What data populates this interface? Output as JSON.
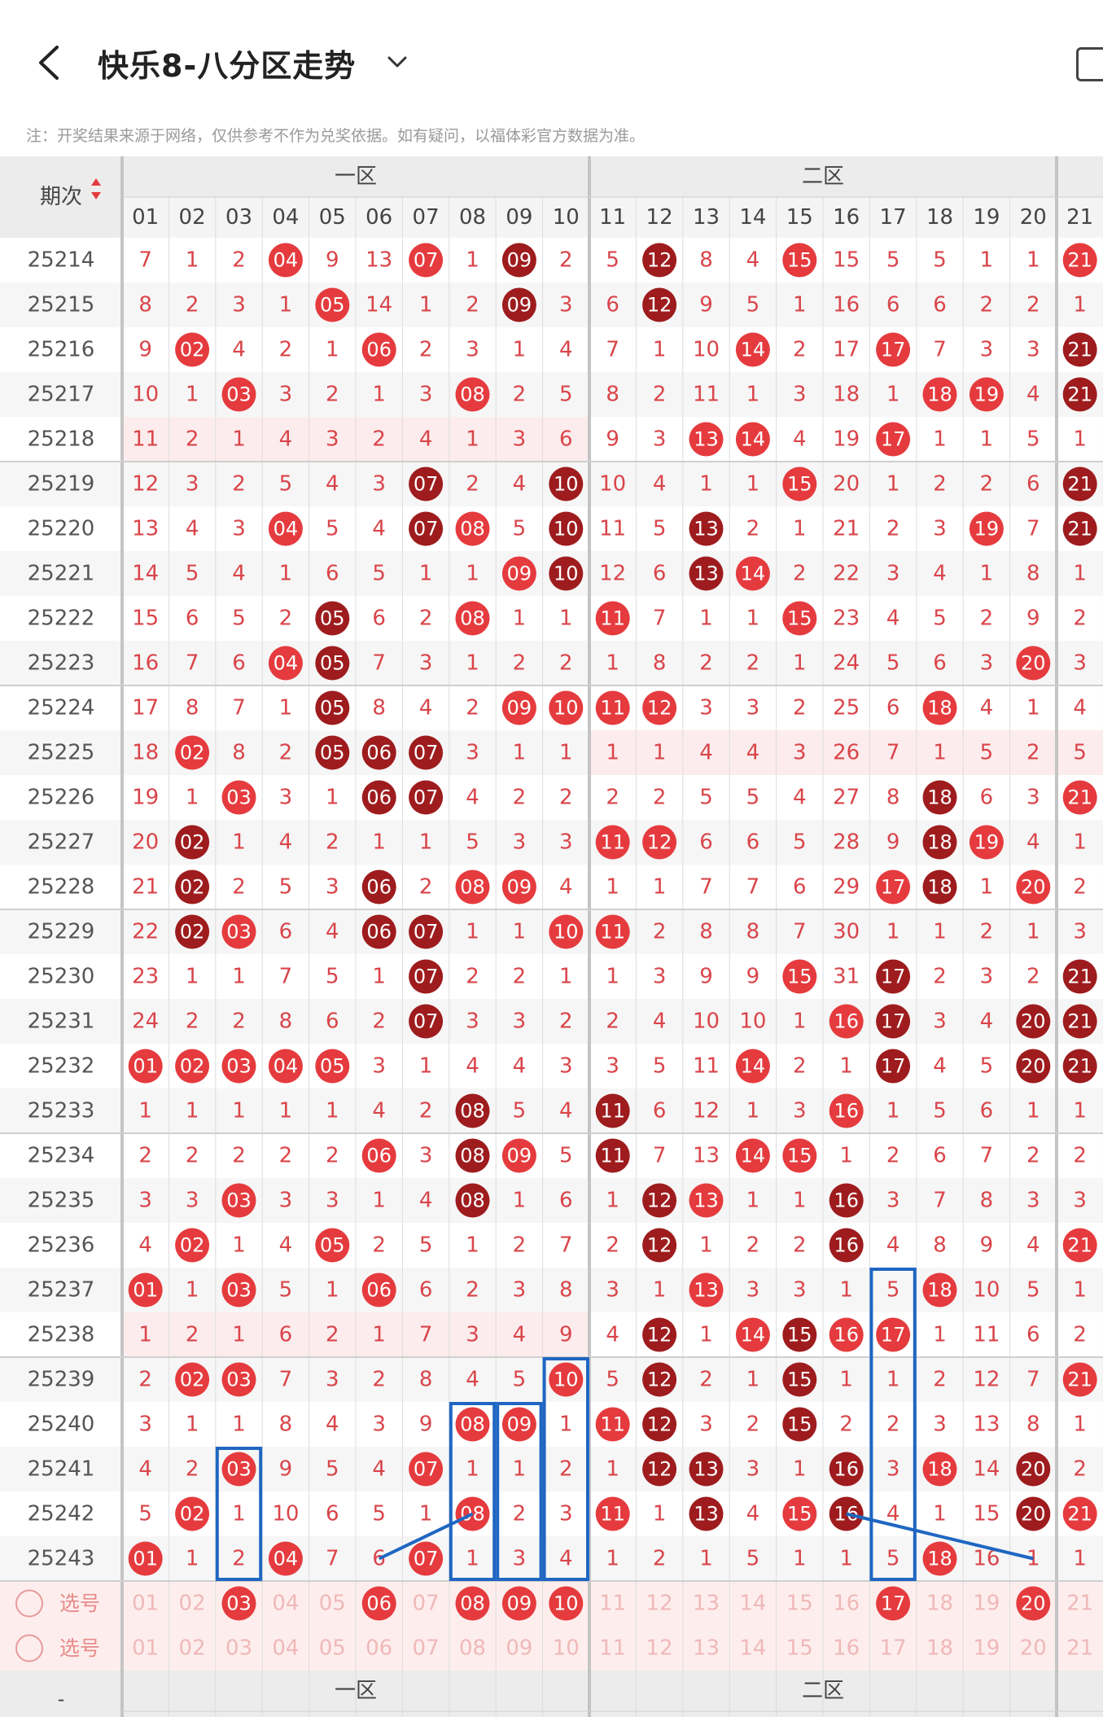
{
  "header": {
    "title": "快乐8-八分区走势",
    "back_icon": "chevron-left-icon",
    "dropdown_icon": "chevron-down-icon",
    "side_icon": "split-view-icon"
  },
  "note": "注：开奖结果来源于网络，仅供参考不作为兑奖依据。如有疑问，以福体彩官方数据为准。",
  "table": {
    "period_header": "期次",
    "zones": [
      "一区",
      "二区"
    ],
    "columns": [
      "01",
      "02",
      "03",
      "04",
      "05",
      "06",
      "07",
      "08",
      "09",
      "10",
      "11",
      "12",
      "13",
      "14",
      "15",
      "16",
      "17",
      "18",
      "19",
      "20",
      "21"
    ],
    "rows": [
      {
        "p": "25214",
        "v": [
          7,
          1,
          2,
          "04",
          9,
          13,
          "07",
          1,
          "09",
          2,
          5,
          "12",
          8,
          4,
          "15",
          15,
          5,
          5,
          1,
          1,
          "21"
        ]
      },
      {
        "p": "25215",
        "v": [
          8,
          2,
          3,
          1,
          "05",
          14,
          1,
          2,
          "09",
          3,
          6,
          "12",
          9,
          5,
          1,
          16,
          6,
          6,
          2,
          2,
          1
        ]
      },
      {
        "p": "25216",
        "v": [
          9,
          "02",
          4,
          2,
          1,
          "06",
          2,
          3,
          1,
          4,
          7,
          1,
          10,
          "14",
          2,
          17,
          "17",
          7,
          3,
          3,
          "21"
        ]
      },
      {
        "p": "25217",
        "v": [
          10,
          1,
          "03",
          3,
          2,
          1,
          3,
          "08",
          2,
          5,
          8,
          2,
          11,
          1,
          3,
          18,
          1,
          "18",
          "19",
          4,
          "21"
        ]
      },
      {
        "p": "25218",
        "v": [
          11,
          2,
          1,
          4,
          3,
          2,
          4,
          1,
          3,
          6,
          9,
          3,
          "13",
          "14",
          4,
          19,
          "17",
          1,
          1,
          5,
          1
        ]
      },
      {
        "p": "25219",
        "v": [
          12,
          3,
          2,
          5,
          4,
          3,
          "07",
          2,
          4,
          "10",
          10,
          4,
          1,
          1,
          "15",
          20,
          1,
          2,
          2,
          6,
          "21"
        ]
      },
      {
        "p": "25220",
        "v": [
          13,
          4,
          3,
          "04",
          5,
          4,
          "07",
          "08",
          5,
          "10",
          11,
          5,
          "13",
          2,
          1,
          21,
          2,
          3,
          "19",
          7,
          "21"
        ]
      },
      {
        "p": "25221",
        "v": [
          14,
          5,
          4,
          1,
          6,
          5,
          1,
          1,
          "09",
          "10",
          12,
          6,
          "13",
          "14",
          2,
          22,
          3,
          4,
          1,
          8,
          1
        ]
      },
      {
        "p": "25222",
        "v": [
          15,
          6,
          5,
          2,
          "05",
          6,
          2,
          "08",
          1,
          1,
          "11",
          7,
          1,
          1,
          "15",
          23,
          4,
          5,
          2,
          9,
          2
        ]
      },
      {
        "p": "25223",
        "v": [
          16,
          7,
          6,
          "04",
          "05",
          7,
          3,
          1,
          2,
          2,
          1,
          8,
          2,
          2,
          1,
          24,
          5,
          6,
          3,
          "20",
          3
        ]
      },
      {
        "p": "25224",
        "v": [
          17,
          8,
          7,
          1,
          "05",
          8,
          4,
          2,
          "09",
          "10",
          "11",
          "12",
          3,
          3,
          2,
          25,
          6,
          "18",
          4,
          1,
          4
        ]
      },
      {
        "p": "25225",
        "v": [
          18,
          "02",
          8,
          2,
          "05",
          "06",
          "07",
          3,
          1,
          1,
          1,
          1,
          4,
          4,
          3,
          26,
          7,
          1,
          5,
          2,
          5
        ]
      },
      {
        "p": "25226",
        "v": [
          19,
          1,
          "03",
          3,
          1,
          "06",
          "07",
          4,
          2,
          2,
          2,
          2,
          5,
          5,
          4,
          27,
          8,
          "18",
          6,
          3,
          "21"
        ]
      },
      {
        "p": "25227",
        "v": [
          20,
          "02",
          1,
          4,
          2,
          1,
          1,
          5,
          3,
          3,
          "11",
          "12",
          6,
          6,
          5,
          28,
          9,
          "18",
          "19",
          4,
          1
        ]
      },
      {
        "p": "25228",
        "v": [
          21,
          "02",
          2,
          5,
          3,
          "06",
          2,
          "08",
          "09",
          4,
          1,
          1,
          7,
          7,
          6,
          29,
          "17",
          "18",
          1,
          "20",
          2
        ]
      },
      {
        "p": "25229",
        "v": [
          22,
          "02",
          "03",
          6,
          4,
          "06",
          "07",
          1,
          1,
          "10",
          "11",
          2,
          8,
          8,
          7,
          30,
          1,
          1,
          2,
          1,
          3
        ]
      },
      {
        "p": "25230",
        "v": [
          23,
          1,
          1,
          7,
          5,
          1,
          "07",
          2,
          2,
          1,
          1,
          3,
          9,
          9,
          "15",
          31,
          "17",
          2,
          3,
          2,
          "21"
        ]
      },
      {
        "p": "25231",
        "v": [
          24,
          2,
          2,
          8,
          6,
          2,
          "07",
          3,
          3,
          2,
          2,
          4,
          10,
          10,
          1,
          "16",
          "17",
          3,
          4,
          "20",
          "21"
        ]
      },
      {
        "p": "25232",
        "v": [
          "01",
          "02",
          "03",
          "04",
          "05",
          3,
          1,
          4,
          4,
          3,
          3,
          5,
          11,
          "14",
          2,
          1,
          "17",
          4,
          5,
          "20",
          "21"
        ]
      },
      {
        "p": "25233",
        "v": [
          1,
          1,
          1,
          1,
          1,
          4,
          2,
          "08",
          5,
          4,
          "11",
          6,
          12,
          1,
          3,
          "16",
          1,
          5,
          6,
          1,
          1
        ]
      },
      {
        "p": "25234",
        "v": [
          2,
          2,
          2,
          2,
          2,
          "06",
          3,
          "08",
          "09",
          5,
          "11",
          7,
          13,
          "14",
          "15",
          1,
          2,
          6,
          7,
          2,
          2
        ]
      },
      {
        "p": "25235",
        "v": [
          3,
          3,
          "03",
          3,
          3,
          1,
          4,
          "08",
          1,
          6,
          1,
          "12",
          "13",
          1,
          1,
          "16",
          3,
          7,
          8,
          3,
          3
        ]
      },
      {
        "p": "25236",
        "v": [
          4,
          "02",
          1,
          4,
          "05",
          2,
          5,
          1,
          2,
          7,
          2,
          "12",
          1,
          2,
          2,
          "16",
          4,
          8,
          9,
          4,
          "21"
        ]
      },
      {
        "p": "25237",
        "v": [
          "01",
          1,
          "03",
          5,
          1,
          "06",
          6,
          2,
          3,
          8,
          3,
          1,
          "13",
          3,
          3,
          1,
          5,
          "18",
          10,
          5,
          1
        ]
      },
      {
        "p": "25238",
        "v": [
          1,
          2,
          1,
          6,
          2,
          1,
          7,
          3,
          4,
          9,
          4,
          "12",
          1,
          "14",
          "15",
          "16",
          "17",
          1,
          11,
          6,
          2
        ]
      },
      {
        "p": "25239",
        "v": [
          2,
          "02",
          "03",
          7,
          3,
          2,
          8,
          4,
          5,
          "10",
          5,
          "12",
          2,
          1,
          "15",
          1,
          1,
          2,
          12,
          7,
          "21"
        ]
      },
      {
        "p": "25240",
        "v": [
          3,
          1,
          1,
          8,
          4,
          3,
          9,
          "08",
          "09",
          1,
          "11",
          "12",
          3,
          2,
          "15",
          2,
          2,
          3,
          13,
          8,
          1
        ]
      },
      {
        "p": "25241",
        "v": [
          4,
          2,
          "03",
          9,
          5,
          4,
          "07",
          1,
          1,
          2,
          1,
          "12",
          "13",
          3,
          1,
          "16",
          3,
          "18",
          14,
          "20",
          2
        ]
      },
      {
        "p": "25242",
        "v": [
          5,
          "02",
          1,
          10,
          6,
          5,
          1,
          "08",
          2,
          3,
          "11",
          1,
          "13",
          4,
          "15",
          "16",
          4,
          1,
          15,
          "20",
          "21"
        ]
      },
      {
        "p": "25243",
        "v": [
          "01",
          1,
          2,
          "04",
          7,
          6,
          "07",
          1,
          3,
          4,
          1,
          2,
          1,
          5,
          1,
          1,
          5,
          "18",
          16,
          1,
          1
        ]
      }
    ],
    "select_rows": [
      {
        "label": "选号",
        "selected": [
          "03",
          "06",
          "08",
          "09",
          "10",
          "17",
          "20"
        ]
      },
      {
        "label": "选号",
        "selected": []
      }
    ],
    "colors": {
      "ball": "#e53b3e",
      "ball_dark": "#9e1c1e",
      "miss_text": "#d9454a",
      "header_bg": "#ececec",
      "row_alt": "#f6f6f6",
      "highlight": "#fdeced",
      "frame": "#1f66c2"
    }
  }
}
